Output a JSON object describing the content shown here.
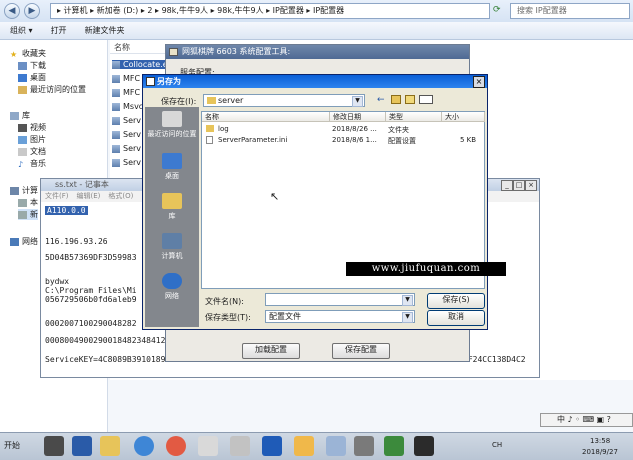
{
  "explorer": {
    "breadcrumb": "▸ 计算机 ▸ 新加卷 (D:) ▸ 2 ▸ 98k,牛牛9人 ▸ 98k,牛牛9人 ▸ IP配置器 ▸ IP配置器",
    "search_placeholder": "搜索 IP配置器",
    "commands": [
      "组织 ▾",
      "打开",
      "新建文件夹"
    ],
    "nav": {
      "favorites": "收藏夹",
      "downloads": "下载",
      "desktop": "桌面",
      "recent": "最近访问的位置",
      "libraries": "库",
      "videos": "视频",
      "pictures": "图片",
      "documents": "文档",
      "music": "音乐",
      "computer": "计算",
      "local": "本",
      "new": "新",
      "network": "网络"
    },
    "column_name": "名称",
    "files": [
      "Collocate.e",
      "MFC",
      "MFC",
      "Msvc",
      "Serv",
      "Serv",
      "Serv",
      "Serv"
    ]
  },
  "notepad": {
    "title": "ss.txt - 记事本",
    "menu": [
      "文件(F)",
      "编辑(E)",
      "格式(O)"
    ],
    "lines": [
      "A110.0.0",
      "116.196.93.26",
      "5D04B57369DF3D59983",
      "bydwx",
      "C:\\Program Files\\Mi",
      "056729506b0fd6aleb9",
      "0002007100290048282",
      "00080049002900184823484123",
      "ServiceKEY=4C8089B3910189",
      "5F24CC138D4C2"
    ]
  },
  "cfgwin": {
    "title": "网狐棋牌 6603 系统配置工具:",
    "service_label": "服务配置:",
    "load_button": "加载配置",
    "save_button": "保存配置"
  },
  "saveas": {
    "title": "另存为",
    "lookin_label": "保存在(I):",
    "lookin_value": "server",
    "places": [
      "最近访问的位置",
      "桌面",
      "库",
      "计算机",
      "网络"
    ],
    "columns": [
      "名称",
      "修改日期",
      "类型",
      "大小"
    ],
    "rows": [
      {
        "name": "log",
        "date": "2018/8/26 ...",
        "type": "文件夹",
        "size": ""
      },
      {
        "name": "ServerParameter.ini",
        "date": "2018/8/6 1...",
        "type": "配置设置",
        "size": "5 KB"
      }
    ],
    "filename_label": "文件名(N):",
    "filename_value": "",
    "filetype_label": "保存类型(T):",
    "filetype_value": "配置文件",
    "save_button": "保存(S)",
    "cancel_button": "取消"
  },
  "watermark": "www.jiufuquan.com",
  "taskbar": {
    "start_label": "开始",
    "lang": "CH",
    "time": "13:58",
    "date": "2018/9/27",
    "ime": "中 ♪ ◦ ⌨ ▣ ?"
  },
  "colors": {
    "xp_title": "#0a5fd6",
    "selection": "#3262ae",
    "places_bar": "#83878d"
  }
}
